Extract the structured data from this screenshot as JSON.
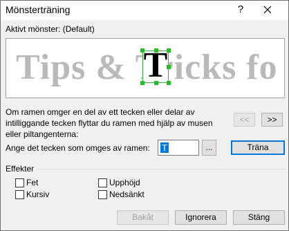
{
  "window": {
    "title": "Mönsterträning",
    "help_glyph": "?",
    "close_icon": "close-icon"
  },
  "pattern": {
    "label": "Aktivt mönster:",
    "value": "(Default)"
  },
  "preview": {
    "text": "Tips & Tricks fo",
    "selected_char": "T",
    "highlight_color": "#22c022"
  },
  "info": {
    "text": "Om ramen omger en del av ett tecken eller delar av intilliggande tecken flyttar du ramen med hjälp av musen eller piltangenterna:"
  },
  "nav": {
    "prev_label": "<<",
    "next_label": ">>"
  },
  "char_entry": {
    "label": "Ange det tecken som omges av ramen:",
    "value": "T",
    "browse_label": "...",
    "train_label": "Träna"
  },
  "effects": {
    "label": "Effekter",
    "bold": {
      "label": "Fet",
      "checked": false
    },
    "italic": {
      "label": "Kursiv",
      "checked": false
    },
    "superscript": {
      "label": "Upphöjd",
      "checked": false
    },
    "subscript": {
      "label": "Nedsänkt",
      "checked": false
    }
  },
  "footer": {
    "back_label": "Bakåt",
    "ignore_label": "Ignorera",
    "close_label": "Stäng"
  },
  "colors": {
    "accent": "#0078d7",
    "preview_text": "#b9b9b9"
  }
}
